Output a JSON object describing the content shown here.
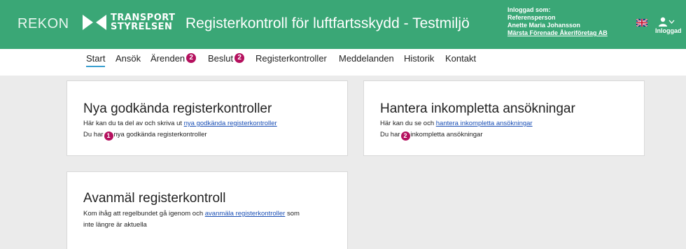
{
  "header": {
    "app_name": "REKON",
    "logo_line1": "TRANSPORT",
    "logo_line2": "STYRELSEN",
    "title": "Registerkontroll för luftfartsskydd - Testmiljö",
    "login_heading": "Inloggad som:",
    "login_role": "Referensperson",
    "login_name": "Anette Maria Johansson",
    "login_org": "Märsta Förenade Åkeriföretag AB",
    "user_label": "Inloggad",
    "language_icon": "uk-flag-icon",
    "user_icon": "user-icon"
  },
  "nav": {
    "items": [
      {
        "label": "Start"
      },
      {
        "label": "Ansök"
      },
      {
        "label": "Ärenden",
        "badge": "2"
      },
      {
        "label": "Beslut",
        "badge": "2"
      },
      {
        "label": "Registerkontroller"
      },
      {
        "label": "Meddelanden"
      },
      {
        "label": "Historik"
      },
      {
        "label": "Kontakt"
      }
    ],
    "active": "Start"
  },
  "cards": {
    "approved": {
      "title": "Nya godkända registerkontroller",
      "line1_prefix": "Här kan du ta del av och skriva ut ",
      "line1_link": "nya godkända registerkontroller",
      "line2_prefix": "Du har",
      "line2_count": "1",
      "line2_suffix": "nya godkända registerkontroller"
    },
    "incomplete": {
      "title": "Hantera inkompletta ansökningar",
      "line1_prefix": "Här kan du se och ",
      "line1_link": "hantera inkompletta ansökningar",
      "line2_prefix": "Du har",
      "line2_count": "2",
      "line2_suffix": "inkompletta ansökningar"
    },
    "deregister": {
      "title": "Avanmäl registerkontroll",
      "line1_prefix": "Kom ihåg att regelbundet gå igenom och ",
      "line1_link": "avanmäla registerkontroller",
      "line1_suffix": " som",
      "line2": "inte längre är aktuella"
    }
  },
  "colors": {
    "header_bg": "#3aa776",
    "badge": "#b5115f",
    "active_underline": "#3aa0d0",
    "link": "#1a4fb5"
  }
}
